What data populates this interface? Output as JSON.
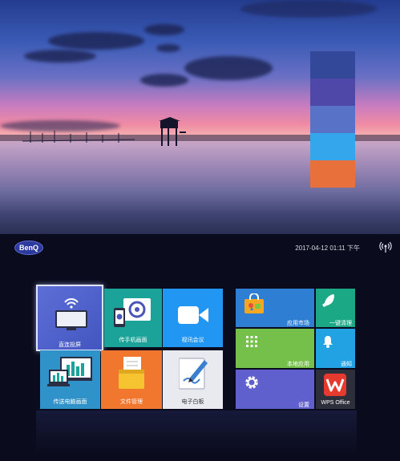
{
  "status": {
    "datetime": "2017-04-12 01:11",
    "ampm": "下午"
  },
  "logo": "BenQ",
  "swatches": [
    "#34489a",
    "#5048a8",
    "#5872c8",
    "#33a6ec",
    "#e8703a"
  ],
  "tiles": {
    "direct_cast": "直连投屏",
    "phone_cast": "传手机画面",
    "video_conf": "视讯会议",
    "pc_cast": "传送电脑画面",
    "file_manager": "文件管理",
    "whiteboard": "电子白板",
    "app_market": "应用市场",
    "one_key_clean": "一键清理",
    "local_apps": "本地应用",
    "notifications": "通知",
    "settings": "设置",
    "wps": "WPS Office"
  }
}
